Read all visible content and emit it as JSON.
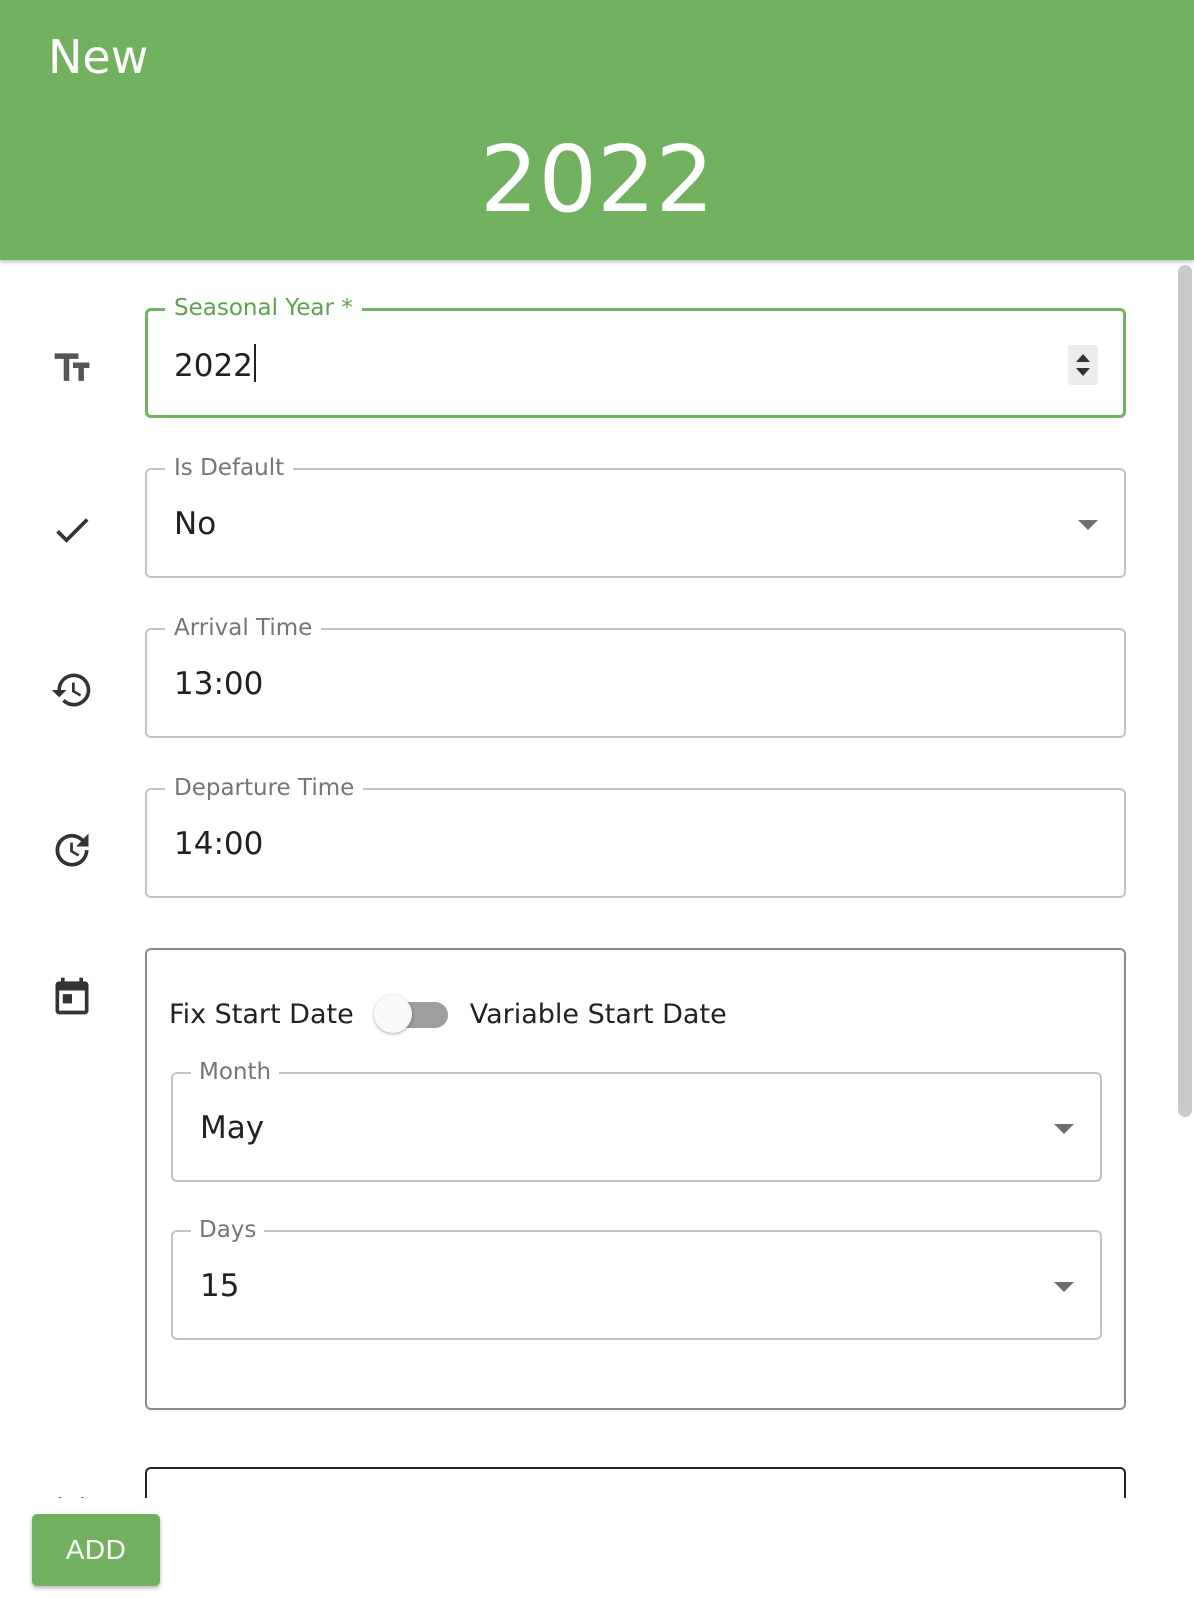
{
  "header": {
    "subtitle": "New",
    "title": "2022"
  },
  "form": {
    "seasonal_year": {
      "label": "Seasonal Year *",
      "value": "2022",
      "icon": "text-size-icon"
    },
    "is_default": {
      "label": "Is Default",
      "value": "No",
      "icon": "check-icon"
    },
    "arrival_time": {
      "label": "Arrival Time",
      "value": "13:00",
      "icon": "history-icon"
    },
    "departure_time": {
      "label": "Departure Time",
      "value": "14:00",
      "icon": "update-icon"
    },
    "start_date": {
      "icon": "calendar-icon",
      "toggle_left_label": "Fix Start Date",
      "toggle_right_label": "Variable Start Date",
      "toggle_on": false,
      "month": {
        "label": "Month",
        "value": "May"
      },
      "days": {
        "label": "Days",
        "value": "15"
      }
    }
  },
  "footer": {
    "add_label": "ADD"
  },
  "colors": {
    "primary": "#72b160",
    "focus_label": "#5fa14f"
  }
}
